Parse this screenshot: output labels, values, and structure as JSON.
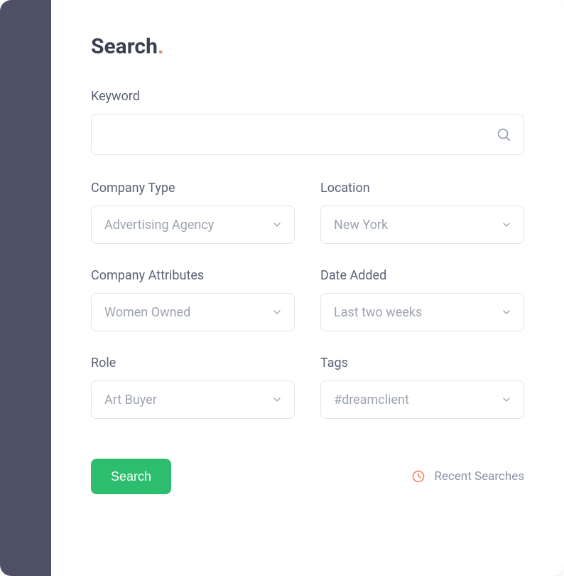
{
  "title": {
    "text": "Search",
    "dot": "."
  },
  "keyword": {
    "label": "Keyword",
    "value": ""
  },
  "fields": {
    "company_type": {
      "label": "Company Type",
      "value": "Advertising Agency"
    },
    "location": {
      "label": "Location",
      "value": "New York"
    },
    "company_attributes": {
      "label": "Company Attributes",
      "value": "Women Owned"
    },
    "date_added": {
      "label": "Date Added",
      "value": "Last two weeks"
    },
    "role": {
      "label": "Role",
      "value": "Art Buyer"
    },
    "tags": {
      "label": "Tags",
      "value": "#dreamclient"
    }
  },
  "actions": {
    "search_button": "Search",
    "recent_searches": "Recent Searches"
  },
  "colors": {
    "sidebar": "#4e5066",
    "accent_dot": "#f1876a",
    "button": "#2dbd6e"
  }
}
